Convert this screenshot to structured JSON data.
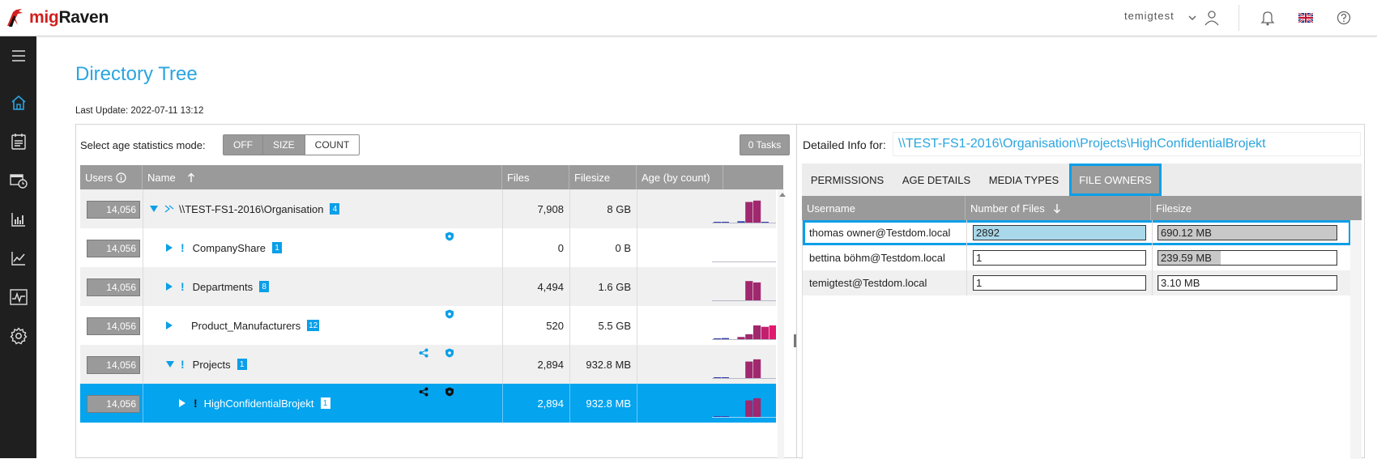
{
  "app": {
    "logo_prefix": "mig",
    "logo_suffix": "Raven"
  },
  "header": {
    "username": "temigtest"
  },
  "page": {
    "title": "Directory Tree",
    "last_update": "Last Update: 2022-07-11 13:12"
  },
  "age_mode": {
    "label": "Select age statistics mode:",
    "options": [
      "OFF",
      "SIZE",
      "COUNT"
    ],
    "selected": "COUNT"
  },
  "tasks_label": "0 Tasks",
  "tree": {
    "columns": {
      "users": "Users",
      "name": "Name",
      "files": "Files",
      "filesize": "Filesize",
      "age": "Age (by count)"
    },
    "rows": [
      {
        "users": "14,056",
        "name": "\\\\TEST-FS1-2016\\Organisation",
        "badge": "4",
        "files": "7,908",
        "filesize": "8 GB",
        "age": [
          0.02,
          0.03,
          0.0,
          0.05,
          0.75,
          0.8,
          0.02,
          0.0,
          0.0
        ],
        "expanded": true,
        "warn": false,
        "level": 0
      },
      {
        "users": "14,056",
        "name": "CompanyShare",
        "badge": "1",
        "files": "0",
        "filesize": "0 B",
        "age": [
          0,
          0,
          0,
          0,
          0,
          0,
          0,
          0,
          0
        ],
        "expanded": false,
        "warn": true,
        "level": 1
      },
      {
        "users": "14,056",
        "name": "Departments",
        "badge": "8",
        "files": "4,494",
        "filesize": "1.6 GB",
        "age": [
          0,
          0,
          0,
          0,
          0.7,
          0.65,
          0,
          0,
          0
        ],
        "expanded": false,
        "warn": true,
        "level": 1
      },
      {
        "users": "14,056",
        "name": "Product_Manufacturers",
        "badge": "12",
        "files": "520",
        "filesize": "5.5 GB",
        "age": [
          0.02,
          0.04,
          0.0,
          0.08,
          0.18,
          0.5,
          0.45,
          0.5,
          0.7
        ],
        "expanded": false,
        "warn": false,
        "level": 1
      },
      {
        "users": "14,056",
        "name": "Projects",
        "badge": "1",
        "files": "2,894",
        "filesize": "932.8 MB",
        "age": [
          0.02,
          0.02,
          0,
          0,
          0.6,
          0.68,
          0,
          0,
          0
        ],
        "expanded": true,
        "warn": true,
        "level": 1
      },
      {
        "users": "14,056",
        "name": "HighConfidentialBrojekt",
        "badge": "1",
        "files": "2,894",
        "filesize": "932.8 MB",
        "age": [
          0.02,
          0.02,
          0,
          0,
          0.6,
          0.68,
          0,
          0,
          0
        ],
        "expanded": false,
        "warn": true,
        "level": 2,
        "selected": true
      }
    ]
  },
  "detail": {
    "label": "Detailed Info for:",
    "path": "\\\\TEST-FS1-2016\\Organisation\\Projects\\HighConfidentialBrojekt",
    "tabs": [
      "PERMISSIONS",
      "AGE DETAILS",
      "MEDIA TYPES",
      "FILE OWNERS"
    ],
    "active_tab": "FILE OWNERS",
    "columns": {
      "username": "Username",
      "files": "Number of Files",
      "filesize": "Filesize"
    },
    "owners": [
      {
        "username": "thomas owner@Testdom.local",
        "files": "2892",
        "files_ratio": 1.0,
        "filesize": "690.12 MB",
        "size_ratio": 1.0
      },
      {
        "username": "bettina böhm@Testdom.local",
        "files": "1",
        "files_ratio": 0.0,
        "filesize": "239.59 MB",
        "size_ratio": 0.35
      },
      {
        "username": "temigtest@Testdom.local",
        "files": "1",
        "files_ratio": 0.0,
        "filesize": "3.10 MB",
        "size_ratio": 0.005
      }
    ]
  },
  "colors": {
    "accent": "#0a9fe8",
    "title": "#2aa5df",
    "bar_files": "#a9d8ea",
    "bar_size": "#c8c8c8",
    "age_purple": "#a0286e",
    "age_pink": "#e0186e",
    "age_blue": "#2f3aa8"
  }
}
